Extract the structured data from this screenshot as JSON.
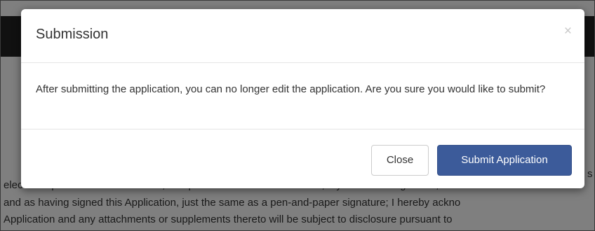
{
  "background": {
    "fragment": "s",
    "lines": [
      "electronic process that constitutes, and provides the CDFI Fund with, my electronic signature, whic",
      "and as having signed this Application, just the same as a pen-and-paper signature; I hereby ackno",
      "Application and any attachments or supplements thereto will be subject to disclosure pursuant to"
    ]
  },
  "modal": {
    "title": "Submission",
    "close_icon": "×",
    "body": "After submitting the application, you can no longer edit the application. Are you sure you would like to submit?",
    "close_button": "Close",
    "submit_button": "Submit Application"
  },
  "colors": {
    "primary": "#3c5b9a",
    "navbar": "#222222"
  }
}
